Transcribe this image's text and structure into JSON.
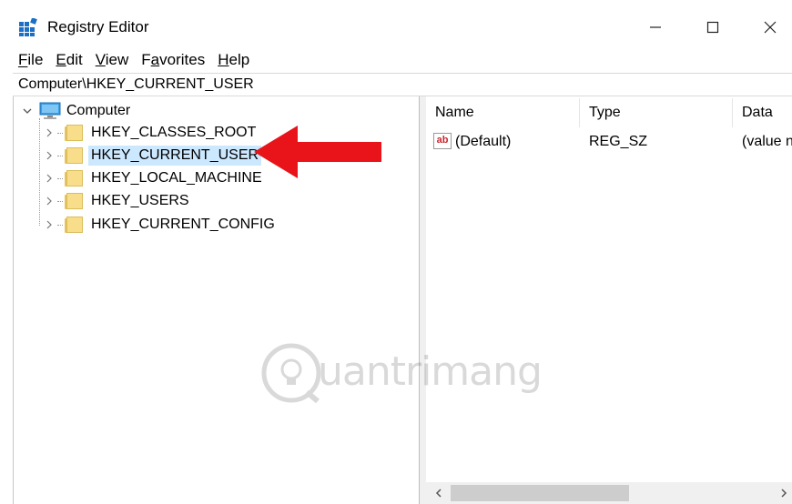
{
  "window": {
    "title": "Registry Editor",
    "minimize_glyph": "—",
    "maximize_glyph": "☐",
    "close_glyph": "✕",
    "icon": "registry-editor-icon"
  },
  "menu": [
    {
      "label": "File",
      "underline": "F"
    },
    {
      "label": "Edit",
      "underline": "E"
    },
    {
      "label": "View",
      "underline": "V"
    },
    {
      "label": "Favorites",
      "underline": "a"
    },
    {
      "label": "Help",
      "underline": "H"
    }
  ],
  "address": "Computer\\HKEY_CURRENT_USER",
  "tree": {
    "root": "Computer",
    "items": [
      {
        "label": "HKEY_CLASSES_ROOT",
        "selected": false
      },
      {
        "label": "HKEY_CURRENT_USER",
        "selected": true
      },
      {
        "label": "HKEY_LOCAL_MACHINE",
        "selected": false
      },
      {
        "label": "HKEY_USERS",
        "selected": false
      },
      {
        "label": "HKEY_CURRENT_CONFIG",
        "selected": false
      }
    ]
  },
  "values": {
    "columns": [
      "Name",
      "Type",
      "Data"
    ],
    "rows": [
      {
        "name": "(Default)",
        "type": "REG_SZ",
        "data": "(value n",
        "icon": "string-value-icon",
        "icon_text": "ab"
      }
    ]
  },
  "annotation": {
    "arrow_color": "#e8141a"
  },
  "watermark": "uantrimang",
  "colors": {
    "selection": "#cce8ff",
    "folder": "#f8dd8a",
    "registry_icon": "#1c6fc4"
  }
}
